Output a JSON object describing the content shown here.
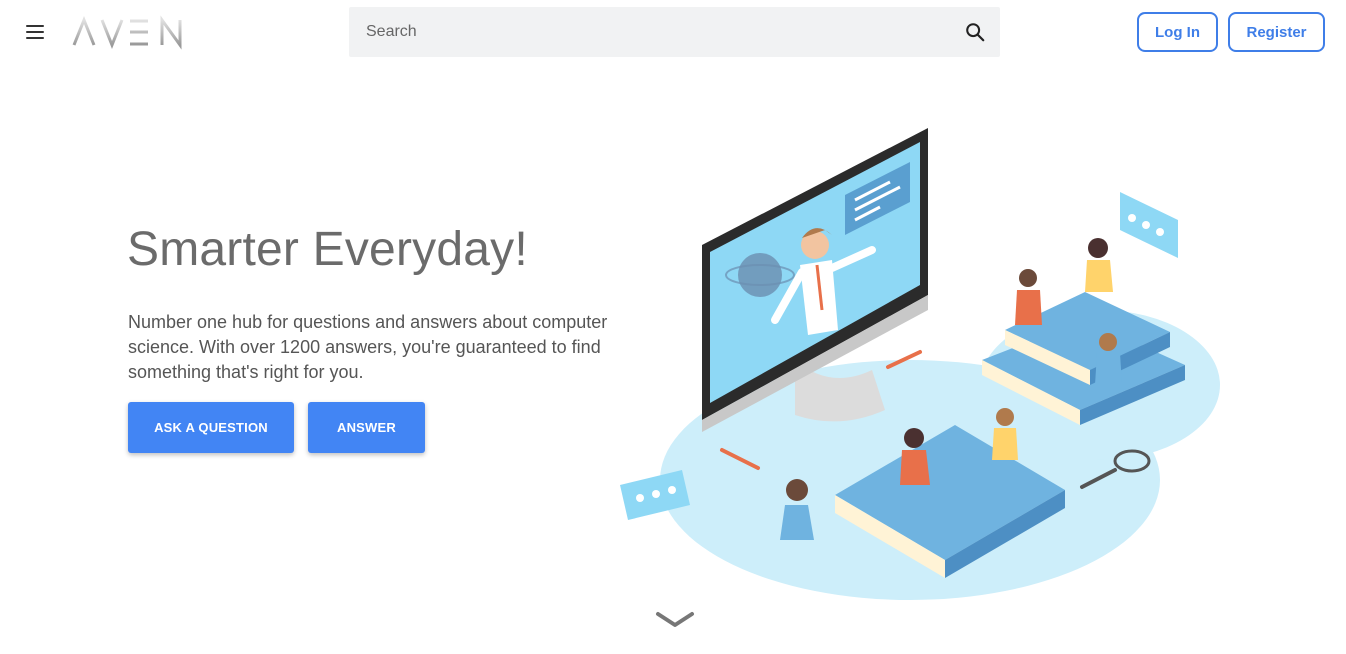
{
  "header": {
    "menu_icon": "hamburger-menu-icon",
    "logo_text": "AVEN",
    "search": {
      "placeholder": "Search",
      "value": "",
      "icon": "search-icon"
    },
    "login_label": "Log In",
    "register_label": "Register"
  },
  "hero": {
    "title": "Smarter Everyday!",
    "description": "Number one hub for questions and answers about computer science. With over 1200 answers, you're guaranteed to find something that's right for you.",
    "ask_label": "ASK A QUESTION",
    "answer_label": "ANSWER"
  },
  "scroll_icon": "chevron-down-icon",
  "colors": {
    "accent": "#4285f4",
    "outline": "#3f7ee8",
    "title": "#6b6b6b",
    "illustration_base": "#c9ecf8",
    "book_blue": "#6fb3e0",
    "screen": "#8ed8f5"
  }
}
